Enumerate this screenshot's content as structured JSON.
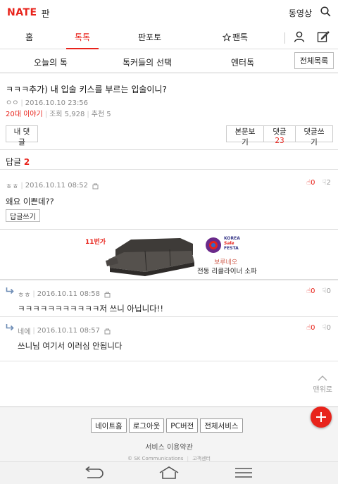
{
  "header": {
    "logo": "NATE",
    "section": "판",
    "video_label": "동영상"
  },
  "gnb": {
    "items": [
      "홈",
      "톡톡",
      "판포토",
      "팬톡"
    ],
    "active": "톡톡"
  },
  "subnav": {
    "items": [
      "오늘의 톡",
      "톡커들의 선택",
      "엔터톡"
    ],
    "all_list_label": "전체목록"
  },
  "post": {
    "title": "ㅋㅋㅋ추가) 내 입술 키스를 부르는 입술이니?",
    "author": "ㅇㅇ",
    "datetime": "2016.10.10 23:56",
    "category": "20대 이야기",
    "views": "조회 5,928",
    "recommend": "추천 5"
  },
  "actions": {
    "my_comments": "내 댓글",
    "view_body": "본문보기",
    "comments_label": "댓글",
    "comments_count": "23",
    "write_comment": "댓글쓰기"
  },
  "replies_section": {
    "label": "답글",
    "count": "2"
  },
  "replies": [
    {
      "author": "ㅎㅎ",
      "datetime": "2016.10.11 08:52",
      "text": "왜요 이쁜데??",
      "up": "0",
      "down": "2",
      "reply_button": "답글쓰기"
    },
    {
      "author": "ㅎㅎ",
      "datetime": "2016.10.11 08:58",
      "text": "ㅋㅋㅋㅋㅋㅋㅋㅋㅋㅋㅋ저 쓰니 아닙니다!!",
      "up": "0",
      "down": "0"
    },
    {
      "author": "네에",
      "datetime": "2016.10.11 08:57",
      "text": "쓰니님 여기서 이러심 안됩니다",
      "up": "0",
      "down": "0"
    }
  ],
  "ad": {
    "badge": "11번가",
    "festa_line1": "KOREA",
    "festa_line2": "Sale",
    "festa_line3": "FESTA",
    "brand": "보루네오",
    "product": "전동 리클라이너 소파"
  },
  "to_top_label": "맨위로",
  "footer": {
    "links": [
      "네이트홈",
      "로그아웃",
      "PC버전",
      "전체서비스"
    ],
    "terms": "서비스 이용약관",
    "copyright": "© SK Communications",
    "support": "고객센터"
  },
  "colors": {
    "accent": "#e8231b",
    "muted": "#888888"
  }
}
